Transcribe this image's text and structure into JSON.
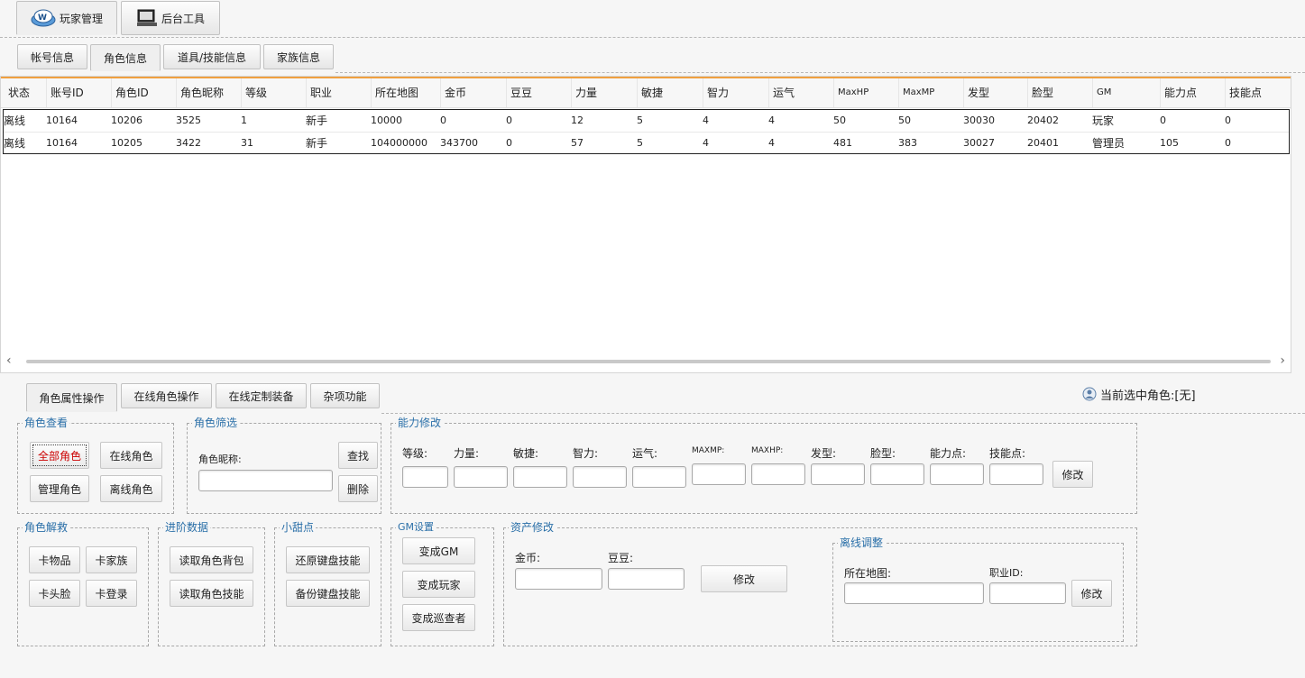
{
  "top_tabs": [
    {
      "label": "玩家管理",
      "icon": "player-logo-icon"
    },
    {
      "label": "后台工具",
      "icon": "monitor-icon"
    }
  ],
  "sub_tabs": [
    "帐号信息",
    "角色信息",
    "道具/技能信息",
    "家族信息"
  ],
  "grid": {
    "columns": [
      "状态",
      "账号ID",
      "角色ID",
      "角色昵称",
      "等级",
      "职业",
      "所在地图",
      "金币",
      "豆豆",
      "力量",
      "敏捷",
      "智力",
      "运气",
      "MaxHP",
      "MaxMP",
      "发型",
      "脸型",
      "GM",
      "能力点",
      "技能点"
    ],
    "rows": [
      [
        "离线",
        "10164",
        "10206",
        "3525",
        "1",
        "新手",
        "10000",
        "0",
        "0",
        "12",
        "5",
        "4",
        "4",
        "50",
        "50",
        "30030",
        "20402",
        "玩家",
        "0",
        "0"
      ],
      [
        "离线",
        "10164",
        "10205",
        "3422",
        "31",
        "新手",
        "104000000",
        "343700",
        "0",
        "57",
        "5",
        "4",
        "4",
        "481",
        "383",
        "30027",
        "20401",
        "管理员",
        "105",
        "0"
      ]
    ]
  },
  "op_tabs": [
    "角色属性操作",
    "在线角色操作",
    "在线定制装备",
    "杂项功能"
  ],
  "current_role": "当前选中角色:[无]",
  "groups": {
    "role_view": {
      "title": "角色查看",
      "buttons": [
        "全部角色",
        "在线角色",
        "管理角色",
        "离线角色"
      ]
    },
    "role_filter": {
      "title": "角色筛选",
      "label": "角色昵称:",
      "search": "查找",
      "delete": "删除"
    },
    "ability": {
      "title": "能力修改",
      "fields": [
        "等级:",
        "力量:",
        "敏捷:",
        "智力:",
        "运气:",
        "MAXMP:",
        "MAXHP:",
        "发型:",
        "脸型:",
        "能力点:",
        "技能点:"
      ],
      "button": "修改"
    },
    "rescue": {
      "title": "角色解救",
      "buttons": [
        "卡物品",
        "卡家族",
        "卡头脸",
        "卡登录"
      ]
    },
    "advanced": {
      "title": "进阶数据",
      "buttons": [
        "读取角色背包",
        "读取角色技能"
      ]
    },
    "sweet": {
      "title": "小甜点",
      "buttons": [
        "还原键盘技能",
        "备份键盘技能"
      ]
    },
    "gm": {
      "title": "GM设置",
      "buttons": [
        "变成GM",
        "变成玩家",
        "变成巡查者"
      ]
    },
    "assets": {
      "title": "资产修改",
      "gold": "金币:",
      "beans": "豆豆:",
      "button": "修改"
    },
    "offline": {
      "title": "离线调整",
      "map": "所在地图:",
      "job": "职业ID:",
      "button": "修改"
    }
  }
}
